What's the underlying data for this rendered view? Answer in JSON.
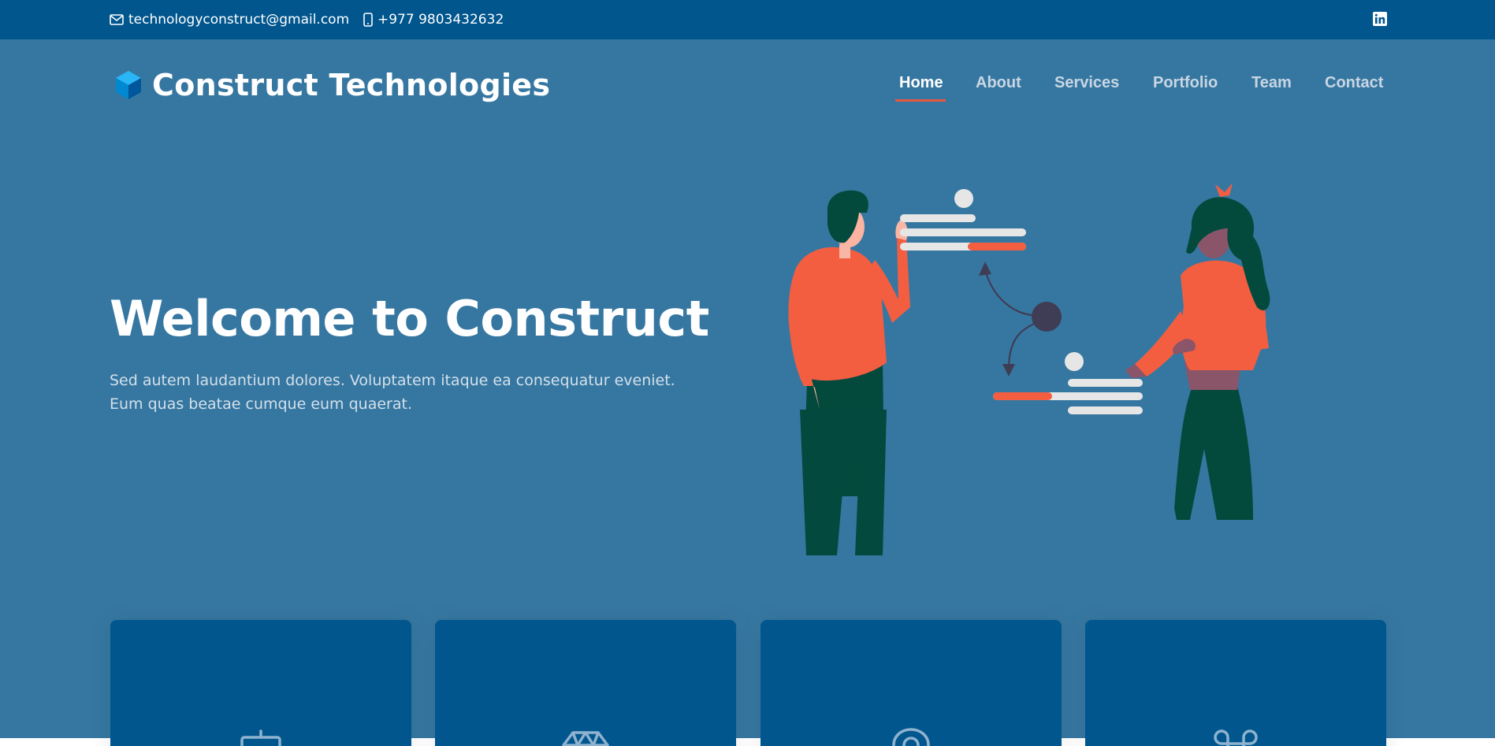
{
  "topbar": {
    "email": "technologyconstruct@gmail.com",
    "phone": "+977 9803432632",
    "icons": {
      "email": "envelope-icon",
      "phone": "mobile-phone-icon",
      "social": "linkedin-icon"
    }
  },
  "header": {
    "logo_text": "Construct Technologies",
    "logo_icon": "cube-logo-icon",
    "nav": [
      {
        "label": "Home",
        "active": true
      },
      {
        "label": "About",
        "active": false
      },
      {
        "label": "Services",
        "active": false
      },
      {
        "label": "Portfolio",
        "active": false
      },
      {
        "label": "Team",
        "active": false
      },
      {
        "label": "Contact",
        "active": false
      }
    ]
  },
  "hero": {
    "title": "Welcome to Construct",
    "subtitle": "Sed autem laudantium dolores. Voluptatem itaque ea consequatur eveniet. Eum quas beatae cumque eum quaerat."
  },
  "cards": [
    {
      "icon": "easel-icon"
    },
    {
      "icon": "diamond-icon"
    },
    {
      "icon": "map-pin-icon"
    },
    {
      "icon": "command-key-icon"
    }
  ],
  "colors": {
    "topbar": "#01568e",
    "hero_bg": "#3677a1",
    "card_bg": "#01568e",
    "accent": "#e9573f",
    "nav_inactive": "#c9d6e3"
  }
}
